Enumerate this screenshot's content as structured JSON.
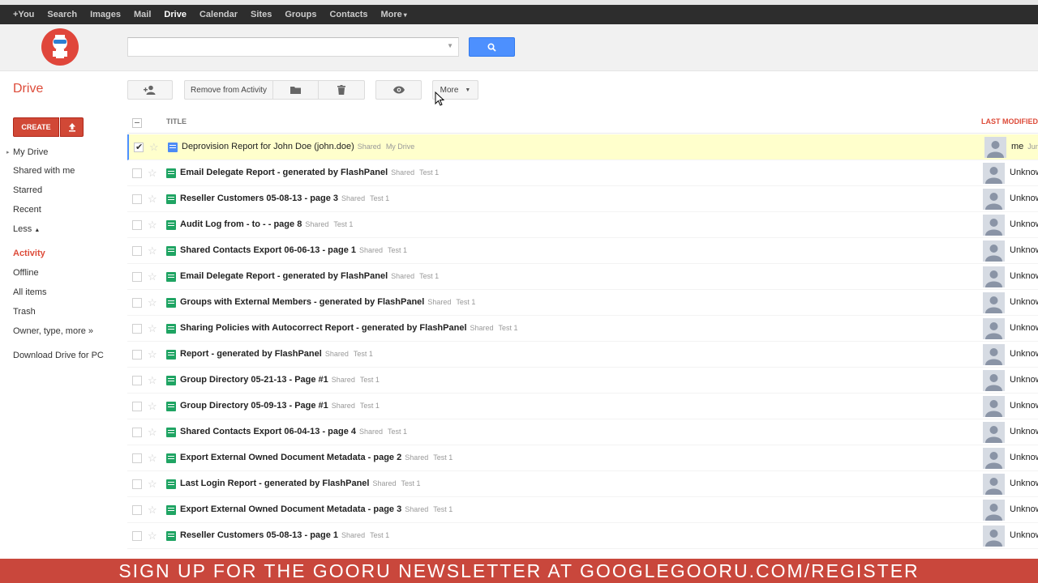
{
  "topnav": {
    "items": [
      "+You",
      "Search",
      "Images",
      "Mail",
      "Drive",
      "Calendar",
      "Sites",
      "Groups",
      "Contacts",
      "More"
    ],
    "active": "Drive"
  },
  "search": {
    "value": "",
    "placeholder": ""
  },
  "app_title": "Drive",
  "create_label": "CREATE",
  "toolbar": {
    "remove_label": "Remove from Activity",
    "more_label": "More"
  },
  "sidebar": {
    "my_drive": "My Drive",
    "shared_with_me": "Shared with me",
    "starred": "Starred",
    "recent": "Recent",
    "less": "Less",
    "activity": "Activity",
    "offline": "Offline",
    "all_items": "All items",
    "trash": "Trash",
    "owner_type_more": "Owner, type, more »",
    "download": "Download Drive for PC"
  },
  "list": {
    "col_title": "TITLE",
    "col_modified": "LAST MODIFIED",
    "rows": [
      {
        "title": "Deprovision Report for John Doe (john.doe)",
        "tag1": "Shared",
        "tag2": "My Drive",
        "owner": "me",
        "date": "Jun",
        "type": "doc",
        "selected": true
      },
      {
        "title": "Email Delegate Report - generated by FlashPanel",
        "tag1": "Shared",
        "tag2": "Test 1",
        "owner": "Unknown",
        "date": "",
        "type": "sheet"
      },
      {
        "title": "Reseller Customers 05-08-13 - page 3",
        "tag1": "Shared",
        "tag2": "Test 1",
        "owner": "Unknown",
        "date": "",
        "type": "sheet"
      },
      {
        "title": "Audit Log from - to - - page 8",
        "tag1": "Shared",
        "tag2": "Test 1",
        "owner": "Unknown",
        "date": "",
        "type": "sheet"
      },
      {
        "title": "Shared Contacts Export 06-06-13 - page 1",
        "tag1": "Shared",
        "tag2": "Test 1",
        "owner": "Unknown",
        "date": "",
        "type": "sheet"
      },
      {
        "title": "Email Delegate Report - generated by FlashPanel",
        "tag1": "Shared",
        "tag2": "Test 1",
        "owner": "Unknown",
        "date": "",
        "type": "sheet"
      },
      {
        "title": "Groups with External Members - generated by FlashPanel",
        "tag1": "Shared",
        "tag2": "Test 1",
        "owner": "Unknown",
        "date": "",
        "type": "sheet"
      },
      {
        "title": "Sharing Policies with Autocorrect Report - generated by FlashPanel",
        "tag1": "Shared",
        "tag2": "Test 1",
        "owner": "Unknown",
        "date": "",
        "type": "sheet"
      },
      {
        "title": "Report - generated by FlashPanel",
        "tag1": "Shared",
        "tag2": "Test 1",
        "owner": "Unknown",
        "date": "",
        "type": "sheet"
      },
      {
        "title": "Group Directory 05-21-13 - Page #1",
        "tag1": "Shared",
        "tag2": "Test 1",
        "owner": "Unknown",
        "date": "",
        "type": "sheet"
      },
      {
        "title": "Group Directory 05-09-13 - Page #1",
        "tag1": "Shared",
        "tag2": "Test 1",
        "owner": "Unknown",
        "date": "",
        "type": "sheet"
      },
      {
        "title": "Shared Contacts Export 06-04-13 - page 4",
        "tag1": "Shared",
        "tag2": "Test 1",
        "owner": "Unknown",
        "date": "",
        "type": "sheet"
      },
      {
        "title": "Export External Owned Document Metadata - page 2",
        "tag1": "Shared",
        "tag2": "Test 1",
        "owner": "Unknown",
        "date": "",
        "type": "sheet"
      },
      {
        "title": "Last Login Report - generated by FlashPanel",
        "tag1": "Shared",
        "tag2": "Test 1",
        "owner": "Unknown",
        "date": "",
        "type": "sheet"
      },
      {
        "title": "Export External Owned Document Metadata - page 3",
        "tag1": "Shared",
        "tag2": "Test 1",
        "owner": "Unknown",
        "date": "",
        "type": "sheet"
      },
      {
        "title": "Reseller Customers 05-08-13 - page 1",
        "tag1": "Shared",
        "tag2": "Test 1",
        "owner": "Unknown",
        "date": "",
        "type": "sheet"
      }
    ]
  },
  "banner": "SIGN UP FOR THE GOORU NEWSLETTER AT GOOGLEGOORU.COM/REGISTER",
  "colors": {
    "accent_red": "#dd4b39",
    "search_blue": "#4d90fe",
    "selected_row": "#ffffcc",
    "sheet_green": "#1fa463",
    "doc_blue": "#4c8bf5",
    "banner_red": "#c9473c"
  },
  "icons": [
    "mascot-logo",
    "search-icon",
    "add-person-icon",
    "folder-icon",
    "trash-icon",
    "eye-icon",
    "upload-icon",
    "star-icon",
    "spreadsheet-icon",
    "document-icon",
    "avatar-placeholder",
    "mouse-cursor"
  ]
}
